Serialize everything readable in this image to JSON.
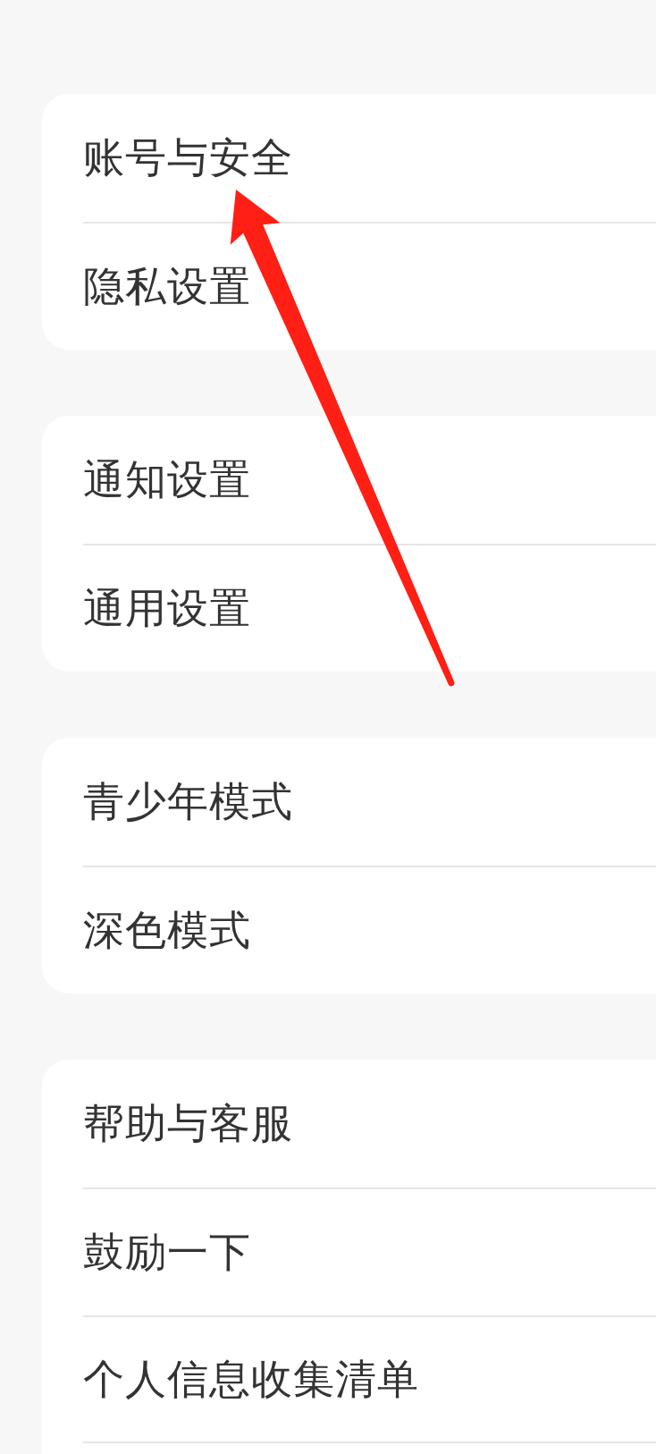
{
  "groups": [
    {
      "items": [
        {
          "label": "账号与安全"
        },
        {
          "label": "隐私设置"
        }
      ],
      "continues": false
    },
    {
      "items": [
        {
          "label": "通知设置"
        },
        {
          "label": "通用设置"
        }
      ],
      "continues": false
    },
    {
      "items": [
        {
          "label": "青少年模式"
        },
        {
          "label": "深色模式"
        }
      ],
      "continues": false
    },
    {
      "items": [
        {
          "label": "帮助与客服"
        },
        {
          "label": "鼓励一下"
        },
        {
          "label": "个人信息收集清单"
        }
      ],
      "continues": true
    }
  ]
}
